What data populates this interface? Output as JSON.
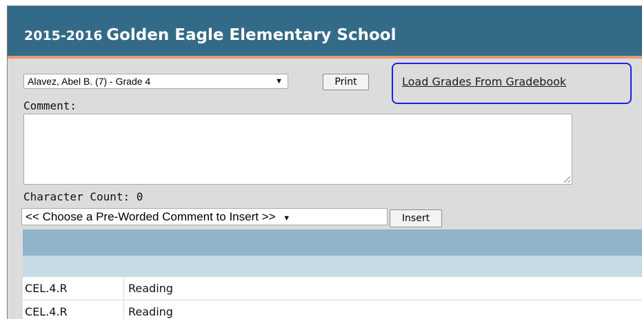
{
  "header": {
    "year": "2015-2016",
    "school_name": "Golden Eagle Elementary School"
  },
  "student_select": {
    "selected": "Alavez, Abel B. (7) - Grade 4"
  },
  "print_button": {
    "label": "Print"
  },
  "load_grades_link": {
    "label": "Load Grades From Gradebook"
  },
  "comment": {
    "label": "Comment:",
    "value": ""
  },
  "character_count": {
    "label": "Character Count: 0"
  },
  "preworded_select": {
    "selected": "<< Choose a Pre-Worded Comment to Insert >>"
  },
  "insert_button": {
    "label": "Insert"
  },
  "table": {
    "rows": [
      {
        "code": "CEL.4.R",
        "subject": "Reading"
      },
      {
        "code": "CEL.4.R",
        "subject": "Reading"
      }
    ]
  },
  "colors": {
    "header_bg": "#336a87",
    "accent": "#e39a71",
    "highlight_border": "#1f1fe8",
    "table_header": "#90b4ca",
    "table_subheader": "#c7dbe5"
  },
  "icons": {
    "select_arrow": "dropdown-arrow-icon",
    "resize": "resize-grip-icon"
  }
}
